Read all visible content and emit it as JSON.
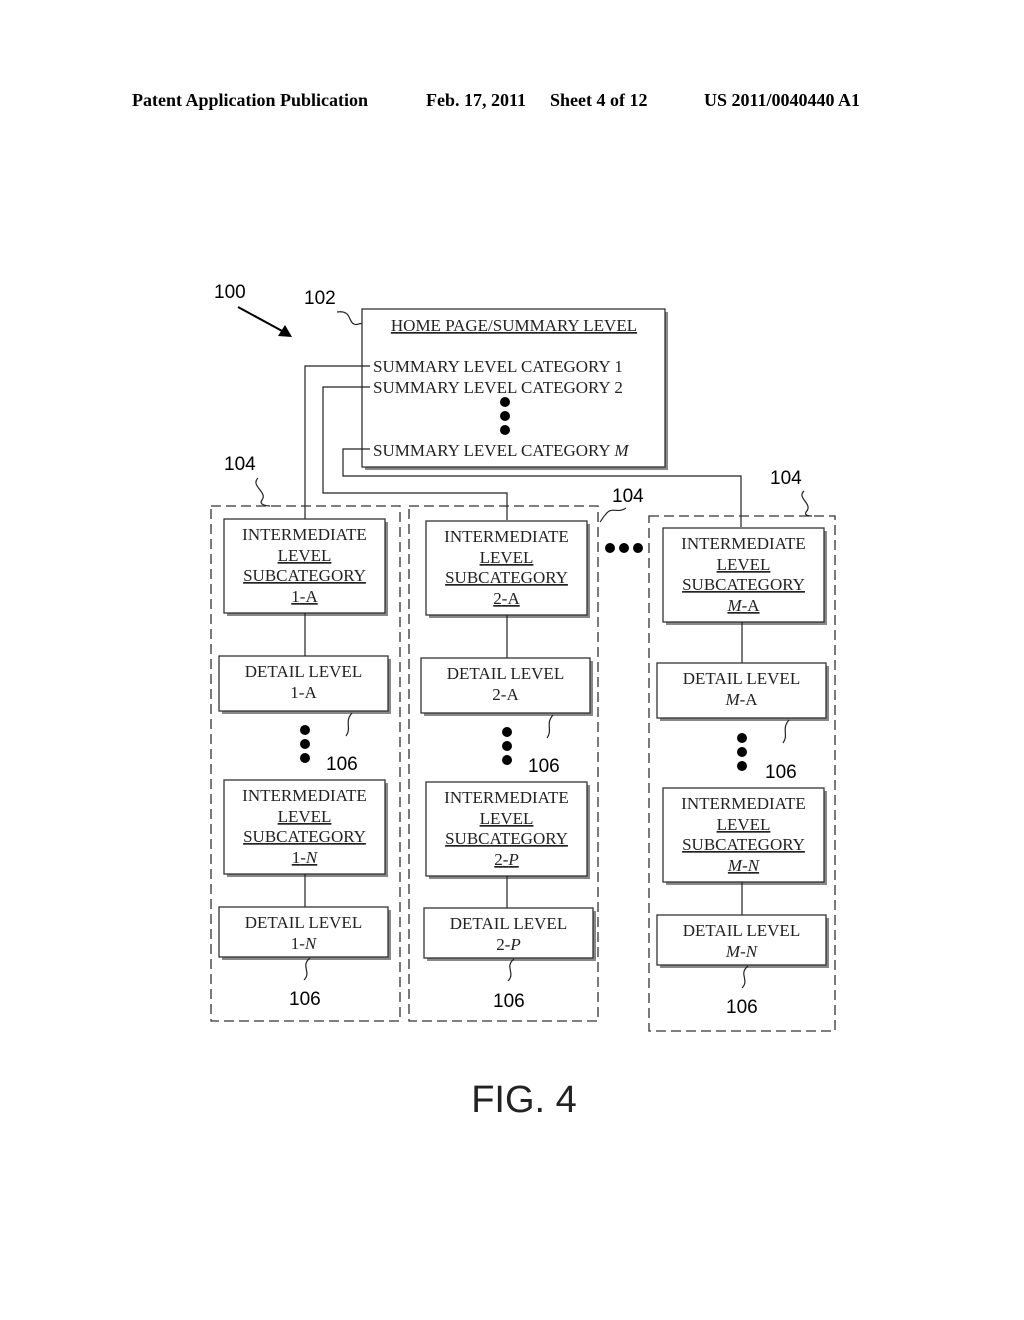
{
  "header": {
    "publication": "Patent Application Publication",
    "date": "Feb. 17, 2011",
    "sheet": "Sheet 4 of 12",
    "number": "US 2011/0040440 A1"
  },
  "figure": {
    "caption": "FIG. 4",
    "refs": {
      "system": "100",
      "home": "102",
      "column": "104",
      "detail": "106"
    },
    "home_box": {
      "title": "HOME PAGE/SUMMARY LEVEL",
      "categories": [
        {
          "text": "SUMMARY LEVEL CATEGORY ",
          "suffix": "1",
          "italic": false
        },
        {
          "text": "SUMMARY LEVEL CATEGORY ",
          "suffix": "2",
          "italic": false
        },
        {
          "text": "SUMMARY LEVEL CATEGORY ",
          "suffix": "M",
          "italic": true
        }
      ]
    },
    "columns": [
      {
        "intermediate_top": {
          "line1": "INTERMEDIATE",
          "line2": "LEVEL",
          "line3": "SUBCATEGORY",
          "id_a": "1",
          "id_sep": "-",
          "id_b": "A",
          "a_italic": false,
          "b_italic": false
        },
        "detail_top": {
          "line1": "DETAIL LEVEL",
          "id_a": "1",
          "id_sep": "-",
          "id_b": "A",
          "a_italic": false,
          "b_italic": false
        },
        "intermediate_bottom": {
          "line1": "INTERMEDIATE",
          "line2": "LEVEL",
          "line3": "SUBCATEGORY",
          "id_a": "1",
          "id_sep": "-",
          "id_b": "N",
          "a_italic": false,
          "b_italic": true
        },
        "detail_bottom": {
          "line1": "DETAIL LEVEL",
          "id_a": "1",
          "id_sep": "-",
          "id_b": "N",
          "a_italic": false,
          "b_italic": true
        }
      },
      {
        "intermediate_top": {
          "line1": "INTERMEDIATE",
          "line2": "LEVEL",
          "line3": "SUBCATEGORY",
          "id_a": "2",
          "id_sep": "-",
          "id_b": "A",
          "a_italic": false,
          "b_italic": false
        },
        "detail_top": {
          "line1": "DETAIL LEVEL",
          "id_a": "2",
          "id_sep": "-",
          "id_b": "A",
          "a_italic": false,
          "b_italic": false
        },
        "intermediate_bottom": {
          "line1": "INTERMEDIATE",
          "line2": "LEVEL",
          "line3": "SUBCATEGORY",
          "id_a": "2",
          "id_sep": "-",
          "id_b": "P",
          "a_italic": false,
          "b_italic": true
        },
        "detail_bottom": {
          "line1": "DETAIL LEVEL",
          "id_a": "2",
          "id_sep": "-",
          "id_b": "P",
          "a_italic": false,
          "b_italic": true
        }
      },
      {
        "intermediate_top": {
          "line1": "INTERMEDIATE",
          "line2": "LEVEL",
          "line3": "SUBCATEGORY",
          "id_a": "M",
          "id_sep": "-",
          "id_b": "A",
          "a_italic": true,
          "b_italic": false
        },
        "detail_top": {
          "line1": "DETAIL LEVEL",
          "id_a": "M",
          "id_sep": "-",
          "id_b": "A",
          "a_italic": true,
          "b_italic": false
        },
        "intermediate_bottom": {
          "line1": "INTERMEDIATE",
          "line2": "LEVEL",
          "line3": "SUBCATEGORY",
          "id_a": "M",
          "id_sep": "-",
          "id_b": "N",
          "a_italic": true,
          "b_italic": true
        },
        "detail_bottom": {
          "line1": "DETAIL LEVEL",
          "id_a": "M",
          "id_sep": "-",
          "id_b": "N",
          "a_italic": true,
          "b_italic": true
        }
      }
    ]
  }
}
